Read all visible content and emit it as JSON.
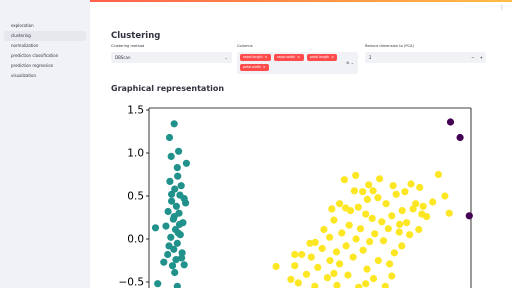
{
  "sidebar": {
    "items": [
      {
        "label": "exploration",
        "active": false
      },
      {
        "label": "clustering",
        "active": true
      },
      {
        "label": "normalization",
        "active": false
      },
      {
        "label": "prediction classification",
        "active": false
      },
      {
        "label": "prediction regression",
        "active": false
      },
      {
        "label": "visualization",
        "active": false
      }
    ]
  },
  "header": {
    "menu_icon": "vertical-dots-icon",
    "menu_glyph": "⋮"
  },
  "main": {
    "title": "Clustering",
    "clustering_method": {
      "label": "Clustering method",
      "value": "DBScan",
      "chevron": "⌄"
    },
    "columns": {
      "label": "Columns",
      "tags": [
        "sepal.length",
        "sepal.width",
        "petal.length",
        "petal.width"
      ],
      "remove_glyph": "×",
      "clear_glyph": "⊗",
      "chevron": "⌄"
    },
    "reduce": {
      "label": "Reduce dimension to (PCA)",
      "value": "2",
      "minus": "−",
      "plus": "+"
    },
    "section_title": "Graphical representation"
  },
  "colors": {
    "accent": "#ff4b4b",
    "teal": "#21918c",
    "yellow": "#fde725",
    "purple": "#440154"
  },
  "chart_data": {
    "type": "scatter",
    "title": "",
    "xlabel": "",
    "ylabel": "",
    "y_ticks": [
      "1.5",
      "1.0",
      "0.5",
      "0.0",
      "−0.5"
    ],
    "ylim": [
      -0.5,
      1.5
    ],
    "xlim": [
      -3.2,
      4.2
    ],
    "grid": false,
    "series": [
      {
        "color": "#21918c",
        "points": [
          [
            -2.62,
            1.34
          ],
          [
            -2.73,
            1.18
          ],
          [
            -2.52,
            1.02
          ],
          [
            -2.34,
            0.88
          ],
          [
            -2.55,
            0.83
          ],
          [
            -2.72,
            0.67
          ],
          [
            -2.61,
            0.58
          ],
          [
            -2.39,
            0.47
          ],
          [
            -2.49,
            0.51
          ],
          [
            -2.68,
            0.44
          ],
          [
            -2.57,
            0.38
          ],
          [
            -2.36,
            0.42
          ],
          [
            -2.76,
            0.32
          ],
          [
            -2.51,
            0.3
          ],
          [
            -2.64,
            0.23
          ],
          [
            -2.42,
            0.19
          ],
          [
            -2.81,
            0.15
          ],
          [
            -2.59,
            0.11
          ],
          [
            -2.48,
            0.05
          ],
          [
            -2.7,
            0.02
          ],
          [
            -2.55,
            -0.05
          ],
          [
            -2.63,
            -0.12
          ],
          [
            -2.44,
            -0.16
          ],
          [
            -2.77,
            -0.18
          ],
          [
            -2.58,
            -0.24
          ],
          [
            -2.66,
            -0.31
          ],
          [
            -2.39,
            -0.3
          ],
          [
            -3.05,
            0.13
          ],
          [
            -2.54,
            0.73
          ],
          [
            -2.46,
            0.62
          ],
          [
            -2.69,
            0.96
          ],
          [
            -2.62,
            0.26
          ],
          [
            -2.53,
            0.07
          ],
          [
            -2.74,
            -0.08
          ],
          [
            -2.45,
            -0.22
          ],
          [
            -2.86,
            -0.27
          ],
          [
            -2.61,
            -0.39
          ],
          [
            -3.0,
            -0.52
          ],
          [
            -2.55,
            -0.55
          ],
          [
            -2.68,
            0.52
          ],
          [
            -2.5,
            0.17
          ]
        ]
      },
      {
        "color": "#fde725",
        "points": [
          [
            1.55,
            0.74
          ],
          [
            1.95,
            0.56
          ],
          [
            1.29,
            0.69
          ],
          [
            2.48,
            0.52
          ],
          [
            2.06,
            0.48
          ],
          [
            1.82,
            0.46
          ],
          [
            1.18,
            0.41
          ],
          [
            2.25,
            0.41
          ],
          [
            1.61,
            0.37
          ],
          [
            1.43,
            0.33
          ],
          [
            2.87,
            0.35
          ],
          [
            2.62,
            0.33
          ],
          [
            1.78,
            0.29
          ],
          [
            2.38,
            0.27
          ],
          [
            1.05,
            0.22
          ],
          [
            1.93,
            0.24
          ],
          [
            2.15,
            0.2
          ],
          [
            1.4,
            0.16
          ],
          [
            2.72,
            0.19
          ],
          [
            0.82,
            0.11
          ],
          [
            1.66,
            0.12
          ],
          [
            2.3,
            0.12
          ],
          [
            1.23,
            0.07
          ],
          [
            1.99,
            0.06
          ],
          [
            2.55,
            0.08
          ],
          [
            0.95,
            0.02
          ],
          [
            1.56,
            0.0
          ],
          [
            0.62,
            -0.04
          ],
          [
            1.87,
            -0.03
          ],
          [
            2.19,
            -0.02
          ],
          [
            1.33,
            -0.08
          ],
          [
            0.78,
            -0.11
          ],
          [
            1.11,
            -0.15
          ],
          [
            1.72,
            -0.13
          ],
          [
            2.44,
            -0.16
          ],
          [
            0.31,
            -0.18
          ],
          [
            0.53,
            -0.21
          ],
          [
            0.96,
            -0.25
          ],
          [
            1.49,
            -0.21
          ],
          [
            2.07,
            -0.25
          ],
          [
            0.15,
            -0.31
          ],
          [
            0.68,
            -0.33
          ],
          [
            1.18,
            -0.29
          ],
          [
            1.81,
            -0.35
          ],
          [
            2.33,
            -0.29
          ],
          [
            0.42,
            -0.41
          ],
          [
            0.9,
            -0.45
          ],
          [
            1.37,
            -0.42
          ],
          [
            1.96,
            -0.46
          ],
          [
            0.23,
            -0.51
          ],
          [
            0.61,
            -0.55
          ],
          [
            1.12,
            -0.54
          ],
          [
            1.62,
            -0.56
          ],
          [
            2.23,
            -0.55
          ],
          [
            -0.28,
            -0.32
          ],
          [
            0.06,
            -0.47
          ],
          [
            2.68,
            0.55
          ],
          [
            2.93,
            0.41
          ],
          [
            3.1,
            0.38
          ],
          [
            3.32,
            0.43
          ],
          [
            3.02,
            0.6
          ],
          [
            2.82,
            0.64
          ],
          [
            3.18,
            0.26
          ],
          [
            2.56,
            0.17
          ],
          [
            3.0,
            0.11
          ],
          [
            1.32,
            0.36
          ],
          [
            1.0,
            0.35
          ],
          [
            1.71,
            0.55
          ],
          [
            2.1,
            0.7
          ],
          [
            1.85,
            0.63
          ],
          [
            2.41,
            0.62
          ],
          [
            1.52,
            0.56
          ],
          [
            2.79,
            0.05
          ],
          [
            1.05,
            -0.4
          ],
          [
            0.5,
            -0.05
          ],
          [
            2.61,
            -0.08
          ],
          [
            1.78,
            -0.52
          ],
          [
            0.15,
            -0.18
          ],
          [
            2.38,
            -0.43
          ],
          [
            3.07,
            0.29
          ],
          [
            3.45,
            0.75
          ],
          [
            3.6,
            0.5
          ],
          [
            3.7,
            0.3
          ]
        ]
      },
      {
        "color": "#440154",
        "points": [
          [
            3.73,
            1.36
          ],
          [
            3.95,
            1.18
          ],
          [
            4.16,
            0.27
          ]
        ]
      }
    ]
  }
}
